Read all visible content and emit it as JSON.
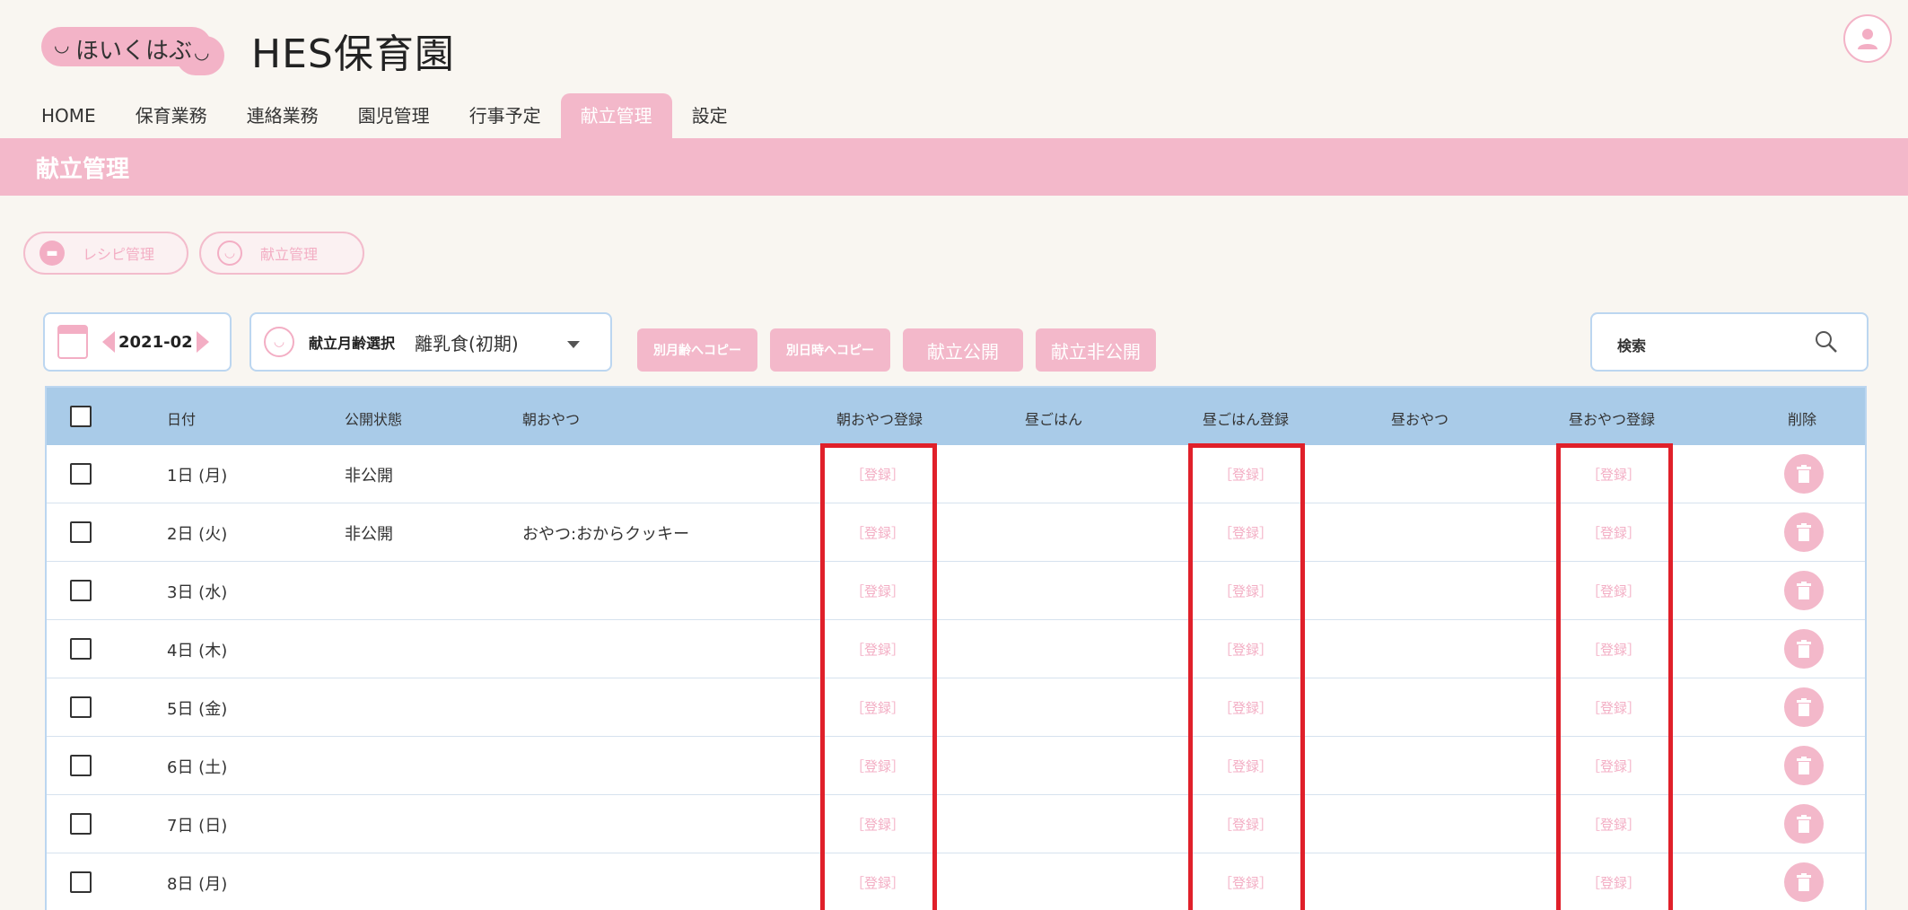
{
  "header": {
    "logo_text": "ほいくはぶ",
    "site_title": "HES保育園"
  },
  "nav": {
    "items": [
      "HOME",
      "保育業務",
      "連絡業務",
      "園児管理",
      "行事予定",
      "献立管理",
      "設定"
    ],
    "active_index": 5
  },
  "page_title": "献立管理",
  "sub_buttons": {
    "recipe": "レシピ管理",
    "menu": "献立管理"
  },
  "toolbar": {
    "date": "2021-02",
    "age_label": "献立月齢選択",
    "age_value": "離乳食(初期)",
    "copy_age": "別月齢へコピー",
    "copy_date": "別日時へコピー",
    "publish": "献立公開",
    "unpublish": "献立非公開",
    "search_label": "検索"
  },
  "table": {
    "headers": {
      "date": "日付",
      "status": "公開状態",
      "morning_snack": "朝おやつ",
      "morning_snack_reg": "朝おやつ登録",
      "lunch": "昼ごはん",
      "lunch_reg": "昼ごはん登録",
      "afternoon_snack": "昼おやつ",
      "afternoon_snack_reg": "昼おやつ登録",
      "delete": "削除"
    },
    "register_label": "［登録］",
    "rows": [
      {
        "date": "1日 (月)",
        "status": "非公開",
        "morning_snack": ""
      },
      {
        "date": "2日 (火)",
        "status": "非公開",
        "morning_snack": "おやつ:おからクッキー"
      },
      {
        "date": "3日 (水)",
        "status": "",
        "morning_snack": ""
      },
      {
        "date": "4日 (木)",
        "status": "",
        "morning_snack": ""
      },
      {
        "date": "5日 (金)",
        "status": "",
        "morning_snack": ""
      },
      {
        "date": "6日 (土)",
        "status": "",
        "morning_snack": ""
      },
      {
        "date": "7日 (日)",
        "status": "",
        "morning_snack": ""
      },
      {
        "date": "8日 (月)",
        "status": "",
        "morning_snack": ""
      }
    ]
  },
  "colors": {
    "accent_pink": "#f3b8ca",
    "header_blue": "#a9cbe8",
    "highlight_red": "#e0202a"
  }
}
